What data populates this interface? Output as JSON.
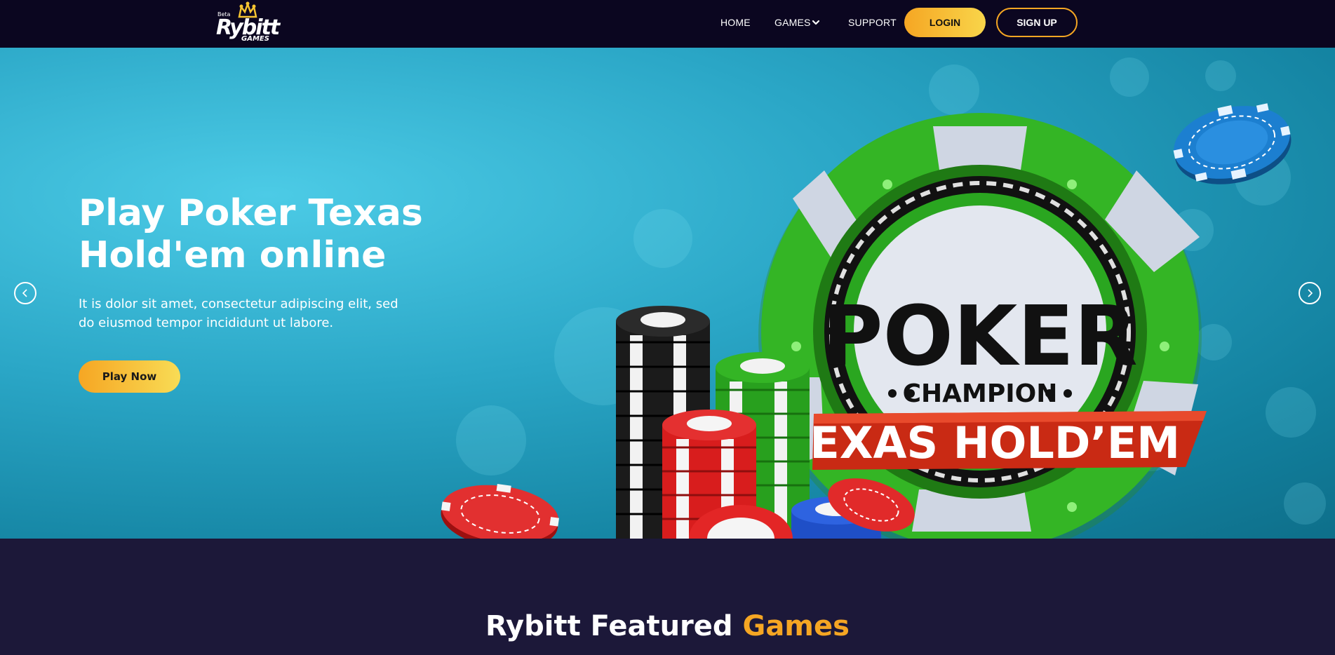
{
  "logo": {
    "beta": "Beta",
    "brand": "Rybitt",
    "sub": "GAMES"
  },
  "nav": {
    "home": "HOME",
    "games": "GAMES",
    "support": "SUPPORT",
    "login": "LOGIN",
    "signup": "SIGN UP"
  },
  "hero": {
    "title": "Play Poker Texas Hold'em online",
    "description": "It is dolor sit amet, consectetur adipiscing elit, sed do eiusmod tempor incididunt ut labore.",
    "cta": "Play Now",
    "chip_text_main": "POKER",
    "chip_text_sub": "CHAMPION",
    "chip_banner": "TEXAS HOLD’EM"
  },
  "featured": {
    "title_main": "Rybitt Featured ",
    "title_accent": "Games"
  },
  "colors": {
    "accent": "#f5a623",
    "header_bg": "#0b0620",
    "section_bg": "#1c1839",
    "hero_bg": "#2aa6c6"
  }
}
